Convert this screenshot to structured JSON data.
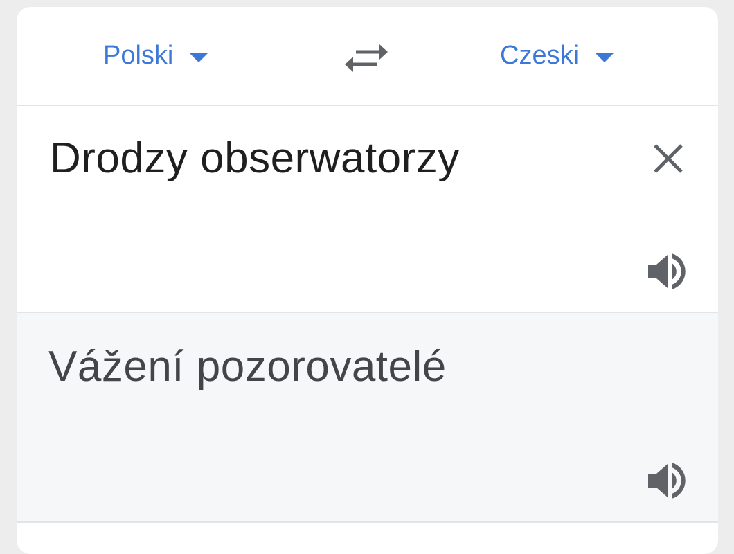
{
  "languages": {
    "source": "Polski",
    "target": "Czeski"
  },
  "input": {
    "text": "Drodzy obserwatorzy"
  },
  "output": {
    "text": "Vážení pozorovatelé"
  },
  "icons": {
    "swap": "swap-arrows-icon",
    "clear": "close-icon",
    "listen": "speaker-icon",
    "dropdown": "caret-down-icon"
  },
  "colors": {
    "accent": "#3b78d8",
    "icon": "#5f6368",
    "output_background": "#f6f7f9"
  }
}
